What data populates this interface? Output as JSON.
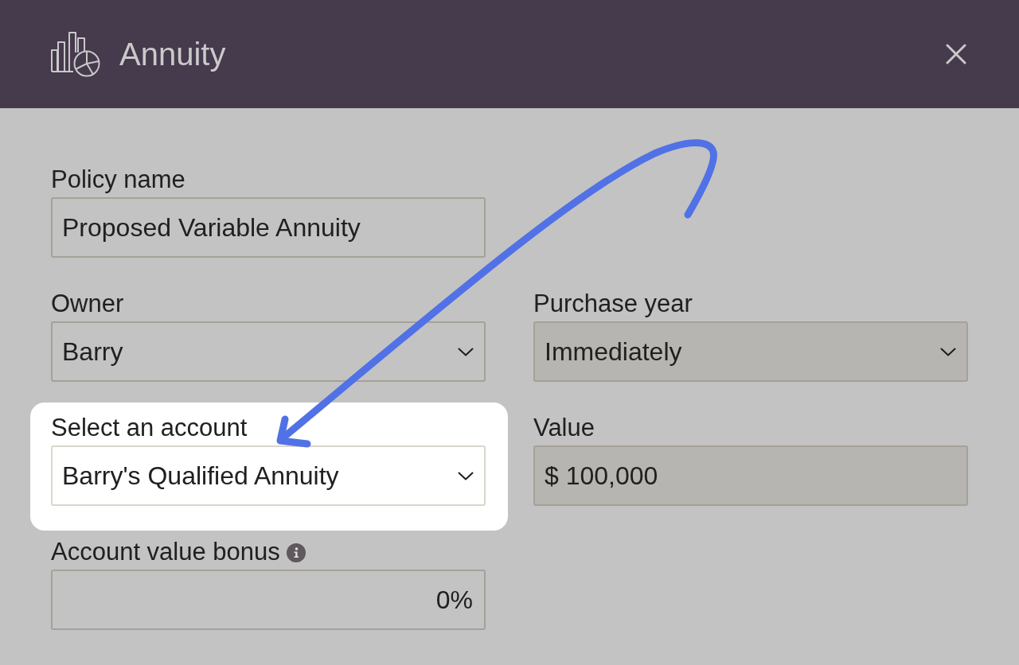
{
  "dialog": {
    "title": "Annuity"
  },
  "rows": [
    {
      "fields": [
        {
          "kind": "text",
          "label": "Policy name",
          "value": "Proposed Variable Annuity",
          "disabled": false,
          "highlighted": false,
          "info": false
        }
      ]
    },
    {
      "fields": [
        {
          "kind": "select",
          "label": "Owner",
          "value": "Barry",
          "disabled": false,
          "highlighted": false,
          "info": false
        },
        {
          "kind": "select",
          "label": "Purchase year",
          "value": "Immediately",
          "disabled": true,
          "highlighted": false,
          "info": false
        }
      ]
    },
    {
      "fields": [
        {
          "kind": "select",
          "label": "Select an account",
          "value": "Barry's Qualified Annuity",
          "disabled": false,
          "highlighted": true,
          "info": false
        },
        {
          "kind": "text",
          "label": "Value",
          "value": "$ 100,000",
          "disabled": true,
          "highlighted": false,
          "info": false
        }
      ]
    },
    {
      "fields": [
        {
          "kind": "percent",
          "label": "Account value bonus",
          "value": "0%",
          "disabled": false,
          "highlighted": false,
          "info": true
        }
      ]
    }
  ]
}
